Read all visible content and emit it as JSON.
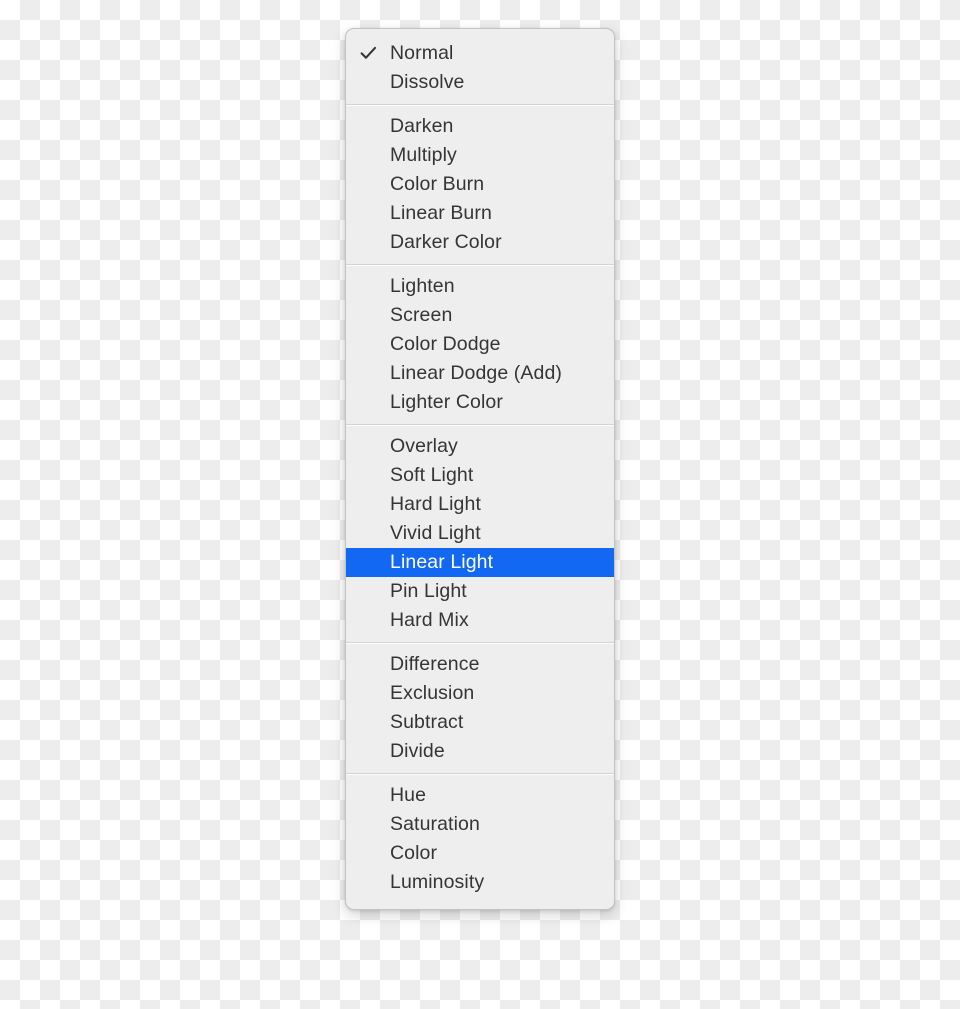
{
  "menu": {
    "name": "blend-mode-menu",
    "background_color": "#eeeeee",
    "text_color": "#353535",
    "highlight_color": "#1268f3",
    "highlight_text_color": "#ffffff",
    "separator_color": "#d3d3d3",
    "checkmark_icon": "checkmark-icon",
    "groups": [
      {
        "items": [
          {
            "label": "Normal",
            "checked": true,
            "selected": false
          },
          {
            "label": "Dissolve",
            "checked": false,
            "selected": false
          }
        ]
      },
      {
        "items": [
          {
            "label": "Darken",
            "checked": false,
            "selected": false
          },
          {
            "label": "Multiply",
            "checked": false,
            "selected": false
          },
          {
            "label": "Color Burn",
            "checked": false,
            "selected": false
          },
          {
            "label": "Linear Burn",
            "checked": false,
            "selected": false
          },
          {
            "label": "Darker Color",
            "checked": false,
            "selected": false
          }
        ]
      },
      {
        "items": [
          {
            "label": "Lighten",
            "checked": false,
            "selected": false
          },
          {
            "label": "Screen",
            "checked": false,
            "selected": false
          },
          {
            "label": "Color Dodge",
            "checked": false,
            "selected": false
          },
          {
            "label": "Linear Dodge (Add)",
            "checked": false,
            "selected": false
          },
          {
            "label": "Lighter Color",
            "checked": false,
            "selected": false
          }
        ]
      },
      {
        "items": [
          {
            "label": "Overlay",
            "checked": false,
            "selected": false
          },
          {
            "label": "Soft Light",
            "checked": false,
            "selected": false
          },
          {
            "label": "Hard Light",
            "checked": false,
            "selected": false
          },
          {
            "label": "Vivid Light",
            "checked": false,
            "selected": false
          },
          {
            "label": "Linear Light",
            "checked": false,
            "selected": true
          },
          {
            "label": "Pin Light",
            "checked": false,
            "selected": false
          },
          {
            "label": "Hard Mix",
            "checked": false,
            "selected": false
          }
        ]
      },
      {
        "items": [
          {
            "label": "Difference",
            "checked": false,
            "selected": false
          },
          {
            "label": "Exclusion",
            "checked": false,
            "selected": false
          },
          {
            "label": "Subtract",
            "checked": false,
            "selected": false
          },
          {
            "label": "Divide",
            "checked": false,
            "selected": false
          }
        ]
      },
      {
        "items": [
          {
            "label": "Hue",
            "checked": false,
            "selected": false
          },
          {
            "label": "Saturation",
            "checked": false,
            "selected": false
          },
          {
            "label": "Color",
            "checked": false,
            "selected": false
          },
          {
            "label": "Luminosity",
            "checked": false,
            "selected": false
          }
        ]
      }
    ]
  }
}
